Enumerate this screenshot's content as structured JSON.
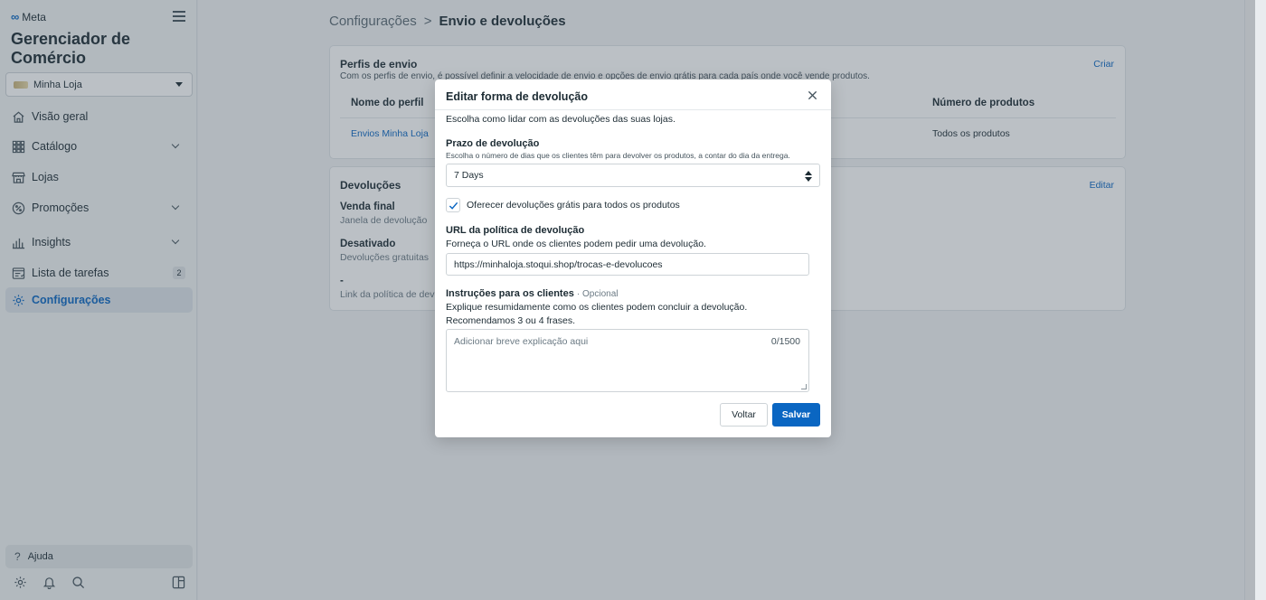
{
  "sidebar": {
    "brand": "Meta",
    "app_title": "Gerenciador de Comércio",
    "store_name": "Minha Loja",
    "nav": [
      {
        "label": "Visão geral"
      },
      {
        "label": "Catálogo"
      },
      {
        "label": "Lojas"
      },
      {
        "label": "Promoções"
      },
      {
        "label": "Insights"
      },
      {
        "label": "Lista de tarefas",
        "badge": "2"
      },
      {
        "label": "Configurações"
      }
    ],
    "help": "Ajuda"
  },
  "breadcrumb": {
    "parent": "Configurações",
    "separator": ">",
    "current": "Envio e devoluções"
  },
  "shipping_card": {
    "title": "Perfis de envio",
    "description": "Com os perfis de envio, é possível definir a velocidade de envio e opções de envio grátis para cada país onde você vende produtos.",
    "action": "Criar",
    "columns": [
      "Nome do perfil",
      "Número de produtos"
    ],
    "rows": [
      {
        "name": "Envios Minha Loja",
        "products": "Todos os produtos"
      }
    ]
  },
  "returns_card": {
    "title": "Devoluções",
    "action": "Editar",
    "items": [
      {
        "title": "Venda final",
        "subtitle": "Janela de devolução"
      },
      {
        "title": "Desativado",
        "subtitle": "Devoluções gratuitas"
      },
      {
        "title": "-",
        "subtitle": "Link da política de devolução"
      }
    ]
  },
  "modal": {
    "title": "Editar forma de devolução",
    "intro": "Escolha como lidar com as devoluções das suas lojas.",
    "deadline_label": "Prazo de devolução",
    "deadline_hint": "Escolha o número de dias que os clientes têm para devolver os produtos, a contar do dia da entrega.",
    "deadline_value": "7 Days",
    "free_returns_label": "Oferecer devoluções grátis para todos os produtos",
    "url_label": "URL da política de devolução",
    "url_hint": "Forneça o URL onde os clientes podem pedir uma devolução.",
    "url_value": "https://minhaloja.stoqui.shop/trocas-e-devolucoes",
    "instructions_label": "Instruções para os clientes",
    "instructions_optional": "· Opcional",
    "instructions_hint_1": "Explique resumidamente como os clientes podem concluir a devolução.",
    "instructions_hint_2": "Recomendamos 3 ou 4 frases.",
    "instructions_placeholder": "Adicionar breve explicação aqui",
    "instructions_counter": "0/1500",
    "back_button": "Voltar",
    "save_button": "Salvar"
  },
  "colors": {
    "accent": "#0a66c2",
    "text": "#1c2b33"
  }
}
